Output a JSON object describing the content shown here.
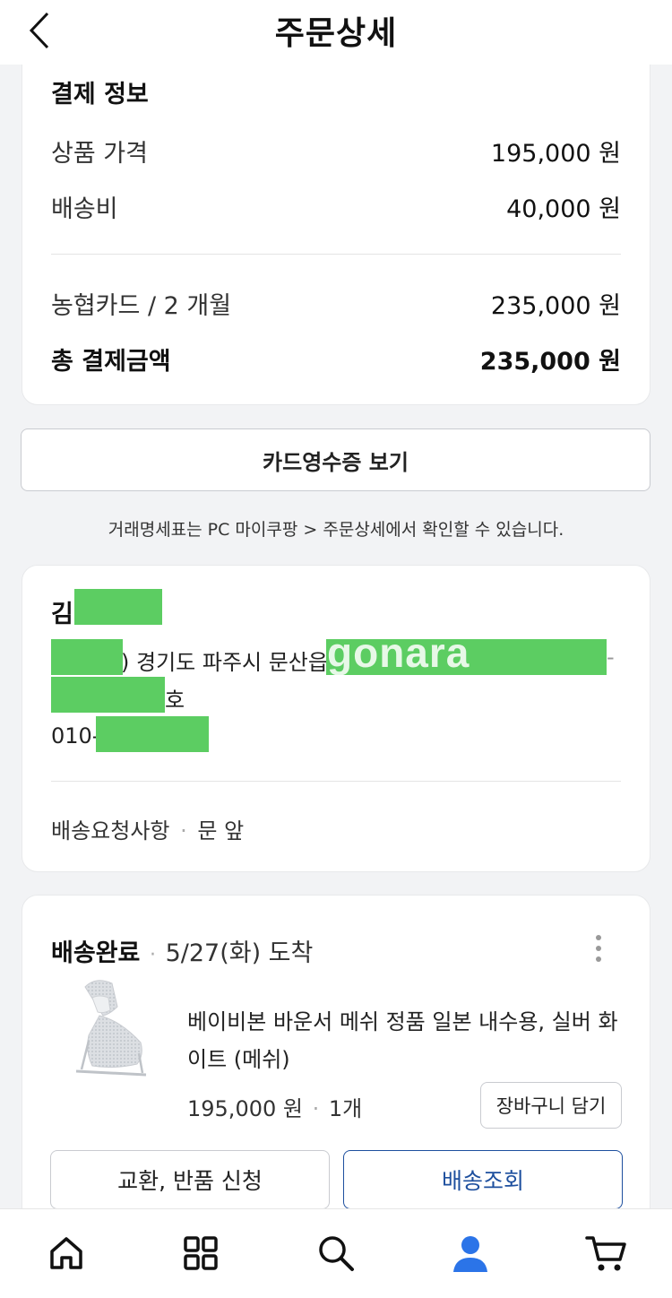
{
  "header": {
    "title": "주문상세"
  },
  "payment": {
    "section_title": "결제 정보",
    "rows": [
      {
        "label": "상품 가격",
        "value": "195,000 원"
      },
      {
        "label": "배송비",
        "value": "40,000 원"
      },
      {
        "label": "농협카드 / 2 개월",
        "value": "235,000 원"
      },
      {
        "label": "총 결제금액",
        "value": "235,000 원"
      }
    ],
    "receipt_button": "카드영수증 보기",
    "notice": "거래명세표는 PC 마이쿠팡 > 주문상세에서 확인할 수 있습니다."
  },
  "shipping": {
    "name_prefix": "김",
    "address_visible": ") 경기도 파주시 문산읍",
    "address_tail": "호",
    "address_dash": "-",
    "phone_prefix": "010-",
    "watermark": "gonara",
    "request_label": "배송요청사항",
    "request_separator": "·",
    "request_value": "문 앞"
  },
  "order": {
    "status": "배송완료",
    "separator": "·",
    "arrival": "5/27(화) 도착",
    "product_name_line1": "베이비본 바운서 메쉬 정품 일본 내수용, 실버 화",
    "product_name_line2": "이트 (메쉬)",
    "price": "195,000 원",
    "qty_separator": "·",
    "quantity": "1개",
    "cart_button": "장바구니 담기",
    "exchange_button": "교환, 반품 신청",
    "tracking_button": "배송조회"
  },
  "tabbar": {
    "items": [
      {
        "icon": "home-icon"
      },
      {
        "icon": "category-grid-icon"
      },
      {
        "icon": "search-icon"
      },
      {
        "icon": "my-account-icon",
        "active": true
      },
      {
        "icon": "cart-icon"
      }
    ]
  },
  "colors": {
    "accent_blue": "#1d4f9e",
    "active_tab": "#2b74e8",
    "redaction_green": "#5ccd62"
  }
}
